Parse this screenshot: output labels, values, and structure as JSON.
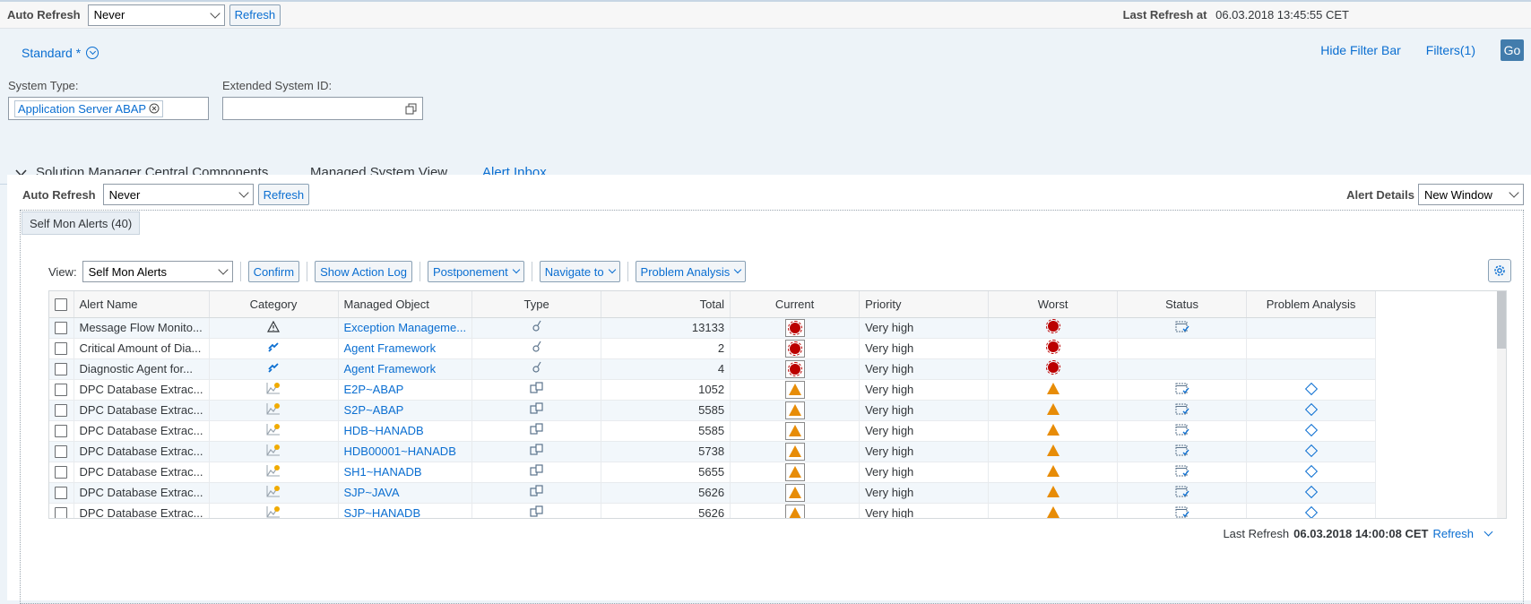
{
  "topbar": {
    "auto_refresh_label": "Auto Refresh",
    "auto_refresh_value": "Never",
    "refresh_button": "Refresh",
    "last_refresh_label": "Last Refresh at",
    "last_refresh_value": "06.03.2018 13:45:55 CET"
  },
  "filterbar": {
    "variant": "Standard *",
    "hide_filter_bar": "Hide Filter Bar",
    "filters": "Filters(1)",
    "go": "Go",
    "system_type_label": "System Type:",
    "system_type_token": "Application Server ABAP",
    "extended_system_id_label": "Extended System ID:",
    "extended_system_id_value": ""
  },
  "tabs": [
    "Solution Manager Central Components",
    "Managed System View",
    "Alert Inbox"
  ],
  "panel": {
    "auto_refresh_label": "Auto Refresh",
    "auto_refresh_value": "Never",
    "refresh_button": "Refresh",
    "alert_details_label": "Alert Details",
    "alert_details_value": "New Window",
    "subtab": "Self Mon Alerts (40)"
  },
  "toolbar": {
    "view_label": "View:",
    "view_value": "Self Mon Alerts",
    "confirm": "Confirm",
    "show_action_log": "Show Action Log",
    "postponement": "Postponement",
    "navigate_to": "Navigate to",
    "problem_analysis": "Problem Analysis"
  },
  "table": {
    "headers": [
      "Alert Name",
      "Category",
      "Managed Object",
      "Type",
      "Total",
      "Current",
      "Priority",
      "Worst",
      "Status",
      "Problem Analysis"
    ],
    "rows": [
      {
        "name": "Message Flow Monito...",
        "category_icon": "warning-triangle-icon",
        "object": "Exception Manageme...",
        "type_icon": "instance-icon",
        "total": "13133",
        "current": "red",
        "priority": "Very high",
        "worst": "red",
        "status": true,
        "analysis": false
      },
      {
        "name": "Critical Amount of Dia...",
        "category_icon": "exception-icon",
        "object": "Agent Framework",
        "type_icon": "instance-icon",
        "total": "2",
        "current": "red",
        "priority": "Very high",
        "worst": "red",
        "status": false,
        "analysis": false
      },
      {
        "name": "Diagnostic Agent for...",
        "category_icon": "exception-icon",
        "object": "Agent Framework",
        "type_icon": "instance-icon",
        "total": "4",
        "current": "red",
        "priority": "Very high",
        "worst": "red",
        "status": false,
        "analysis": false
      },
      {
        "name": "DPC Database Extrac...",
        "category_icon": "performance-icon",
        "object": "E2P~ABAP",
        "type_icon": "technical-system-icon",
        "total": "1052",
        "current": "yellow",
        "priority": "Very high",
        "worst": "yellow",
        "status": true,
        "analysis": true
      },
      {
        "name": "DPC Database Extrac...",
        "category_icon": "performance-icon",
        "object": "S2P~ABAP",
        "type_icon": "technical-system-icon",
        "total": "5585",
        "current": "yellow",
        "priority": "Very high",
        "worst": "yellow",
        "status": true,
        "analysis": true
      },
      {
        "name": "DPC Database Extrac...",
        "category_icon": "performance-icon",
        "object": "HDB~HANADB",
        "type_icon": "technical-system-icon",
        "total": "5585",
        "current": "yellow",
        "priority": "Very high",
        "worst": "yellow",
        "status": true,
        "analysis": true
      },
      {
        "name": "DPC Database Extrac...",
        "category_icon": "performance-icon",
        "object": "HDB00001~HANADB",
        "type_icon": "technical-system-icon",
        "total": "5738",
        "current": "yellow",
        "priority": "Very high",
        "worst": "yellow",
        "status": true,
        "analysis": true
      },
      {
        "name": "DPC Database Extrac...",
        "category_icon": "performance-icon",
        "object": "SH1~HANADB",
        "type_icon": "technical-system-icon",
        "total": "5655",
        "current": "yellow",
        "priority": "Very high",
        "worst": "yellow",
        "status": true,
        "analysis": true
      },
      {
        "name": "DPC Database Extrac...",
        "category_icon": "performance-icon",
        "object": "SJP~JAVA",
        "type_icon": "technical-system-icon",
        "total": "5626",
        "current": "yellow",
        "priority": "Very high",
        "worst": "yellow",
        "status": true,
        "analysis": true
      },
      {
        "name": "DPC Database Extrac...",
        "category_icon": "performance-icon",
        "object": "SJP~HANADB",
        "type_icon": "technical-system-icon",
        "total": "5626",
        "current": "yellow",
        "priority": "Very high",
        "worst": "yellow",
        "status": true,
        "analysis": true
      }
    ]
  },
  "footer": {
    "last_refresh_label": "Last Refresh",
    "last_refresh_value": "06.03.2018 14:00:08 CET",
    "refresh_link": "Refresh"
  },
  "colors": {
    "accent": "#0a6ed1",
    "alert_red": "#bb0000",
    "alert_orange": "#e78c07"
  }
}
